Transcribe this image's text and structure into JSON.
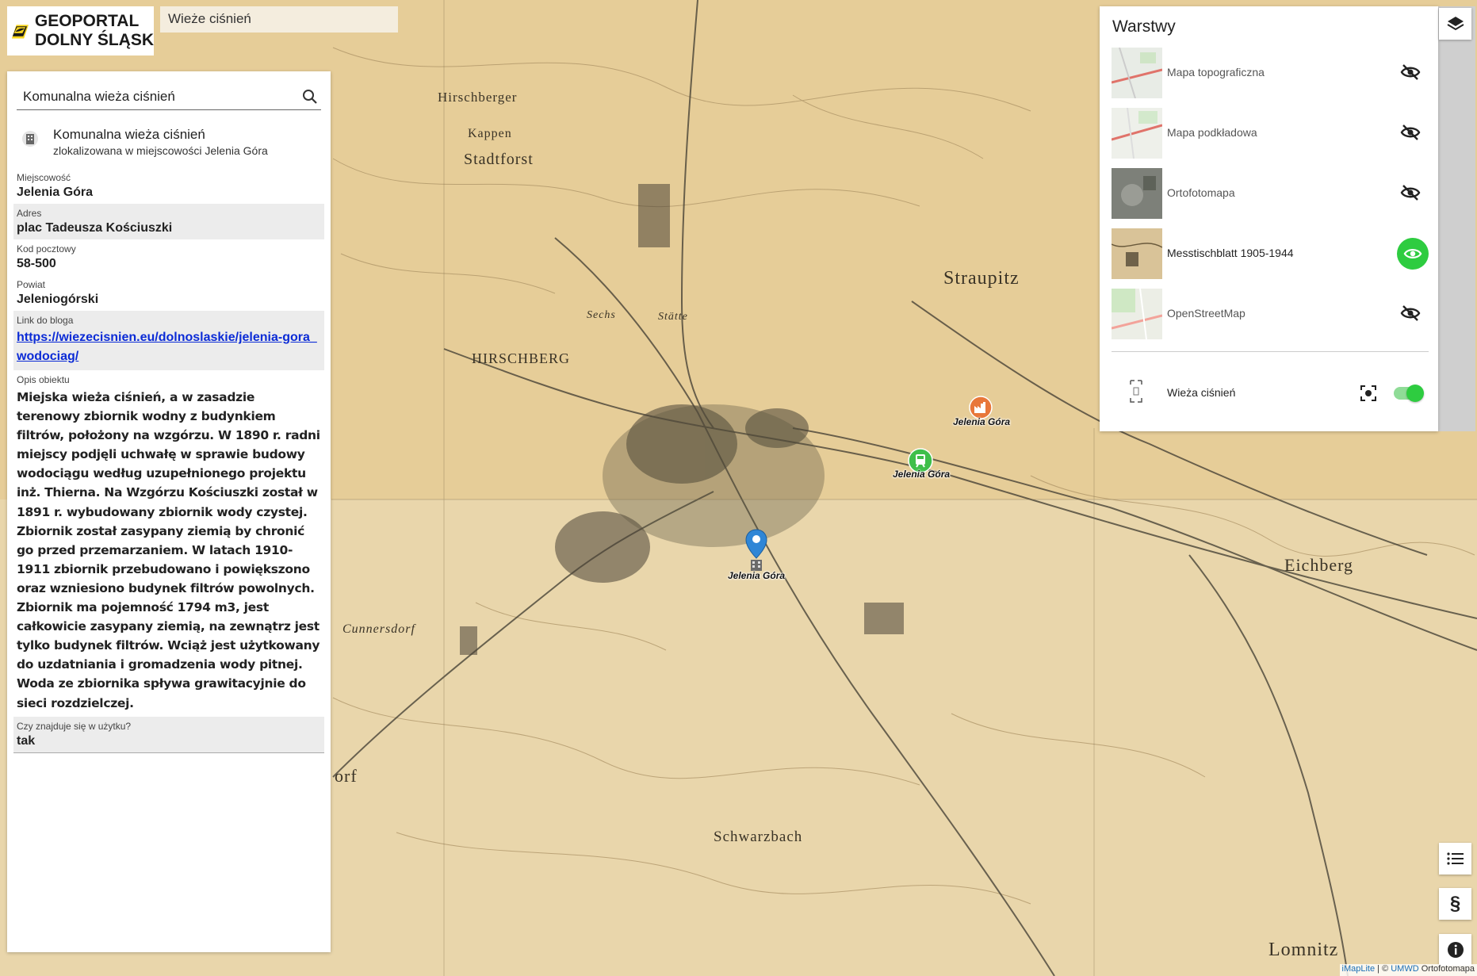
{
  "app": {
    "logo_line1": "GEOPORTAL",
    "logo_line2": "DOLNY ŚLĄSK",
    "top_search_value": "Wieże ciśnień"
  },
  "panel": {
    "search_value": "Komunalna wieża ciśnień",
    "result_title": "Komunalna wieża ciśnień",
    "result_subtitle": "zlokalizowana w miejscowości Jelenia Góra",
    "fields": [
      {
        "label": "Miejscowość",
        "value": "Jelenia Góra"
      },
      {
        "label": "Adres",
        "value": "plac Tadeusza Kościuszki"
      },
      {
        "label": "Kod pocztowy",
        "value": "58-500"
      },
      {
        "label": "Powiat",
        "value": "Jeleniogórski"
      },
      {
        "label": "Link do bloga",
        "value": "https://wiezecisnien.eu/dolnoslaskie/jelenia-gora_wodociag/"
      },
      {
        "label": "Opis obiektu",
        "value": "Miejska wieża ciśnień, a w zasadzie terenowy zbiornik wodny z budynkiem filtrów, położony na wzgórzu. W 1890 r. radni miejscy podjęli uchwałę w sprawie budowy wodociągu według uzupełnionego projektu inż. Thierna. Na Wzgórzu Kościuszki został w 1891 r. wybudowany zbiornik wody czystej. Zbiornik został zasypany ziemią by chronić go przed przemarzaniem. W latach 1910-1911 zbiornik przebudowano i powiększono oraz wzniesiono budynek filtrów powolnych. Zbiornik ma pojemność 1794 m3, jest całkowicie zasypany ziemią, na zewnątrz jest tylko budynek filtrów. Wciąż jest użytkowany do uzdatniania i gromadzenia wody pitnej. Woda ze zbiornika spływa grawitacyjnie do sieci rozdzielczej."
      },
      {
        "label": "Czy znajduje się w użytku?",
        "value": "tak"
      }
    ]
  },
  "layers": {
    "title": "Warstwy",
    "items": [
      {
        "name": "Mapa topograficzna",
        "visible": false
      },
      {
        "name": "Mapa podkładowa",
        "visible": false
      },
      {
        "name": "Ortofotomapa",
        "visible": false
      },
      {
        "name": "Messtischblatt 1905-1944",
        "visible": true
      },
      {
        "name": "OpenStreetMap",
        "visible": false
      }
    ],
    "overlay": {
      "name": "Wieża ciśnień",
      "enabled": true
    }
  },
  "map": {
    "labels": [
      "Hirschberger",
      "Kappen",
      "Stadtforst",
      "Straupitz",
      "HIRSCHBERG",
      "Cunnersdorf",
      "Eichberg",
      "Schwarzbach",
      "Lomnitz",
      "Sechs",
      "Stätte",
      "orf"
    ],
    "markers": [
      {
        "label": "Jelenia Góra",
        "icon": "factory-icon",
        "color": "#e8773a"
      },
      {
        "label": "Jelenia Góra",
        "icon": "train-icon",
        "color": "#3fbf4a"
      },
      {
        "label": "Jelenia Góra",
        "icon": "building-icon",
        "color": "#2f86d6"
      }
    ]
  },
  "attribution": {
    "link1": "iMapLite",
    "sep": " | © ",
    "link2": "UMWD",
    "rest": " Ortofotomapa"
  }
}
